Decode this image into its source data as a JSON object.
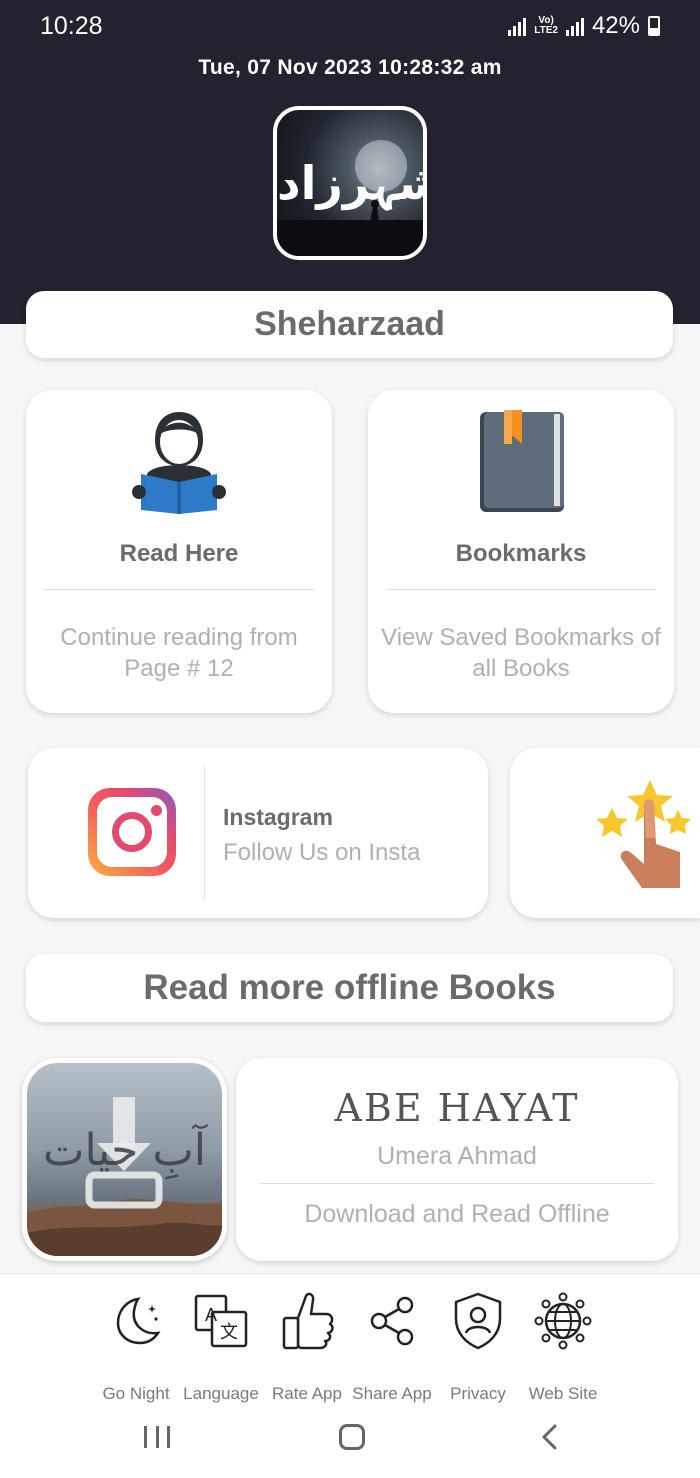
{
  "status_bar": {
    "time": "10:28",
    "network": "LTE2",
    "battery": "42%"
  },
  "header": {
    "datetime": "Tue, 07  Nov  2023   10:28:32 am",
    "logo_text": "شہرزاد"
  },
  "app_title": "Sheharzaad",
  "cards": {
    "read": {
      "title": "Read Here",
      "subtitle": "Continue reading from Page # 12",
      "icon": "reader-icon"
    },
    "bookmarks": {
      "title": "Bookmarks",
      "subtitle": "View Saved Bookmarks of all Books",
      "icon": "book-bookmark-icon"
    }
  },
  "instagram": {
    "title": "Instagram",
    "subtitle": "Follow Us on Insta",
    "icon": "instagram-icon"
  },
  "rate_card": {
    "icon": "stars-hand-icon"
  },
  "section_title": "Read more offline Books",
  "book": {
    "title": "ABE  HAYAT",
    "author": "Umera Ahmad",
    "action": "Download and Read Offline",
    "cover_text": "آبِ حیات"
  },
  "bottom_nav": [
    {
      "label": "Go Night",
      "icon": "moon-icon"
    },
    {
      "label": "Language",
      "icon": "translate-icon"
    },
    {
      "label": "Rate App",
      "icon": "thumbs-up-icon"
    },
    {
      "label": "Share App",
      "icon": "share-icon"
    },
    {
      "label": "Privacy",
      "icon": "shield-user-icon"
    },
    {
      "label": "Web Site",
      "icon": "globe-icon"
    }
  ],
  "colors": {
    "header_bg": "#23222e",
    "card_title": "#6b6b6b",
    "card_subtitle": "#b0b0b0",
    "accent_blue": "#2f7ac8",
    "bookmark_orange": "#f5901e"
  }
}
